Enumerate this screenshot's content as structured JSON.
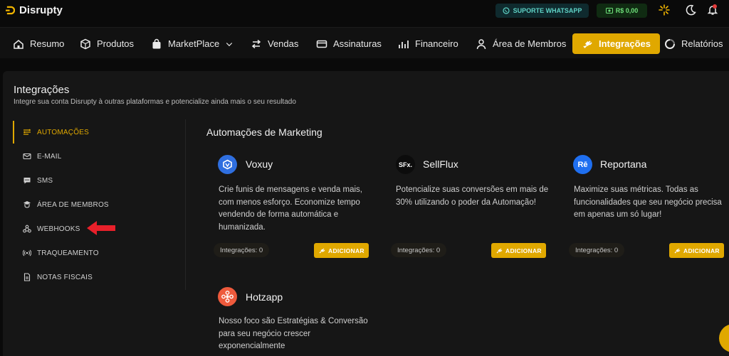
{
  "app": {
    "name": "Disrupty"
  },
  "topbar": {
    "support_label": "SUPORTE WHATSAPP",
    "balance": "R$ 0,00"
  },
  "nav": [
    {
      "label": "Resumo",
      "icon": "home-icon"
    },
    {
      "label": "Produtos",
      "icon": "box-icon"
    },
    {
      "label": "MarketPlace",
      "icon": "bag-icon"
    },
    {
      "label": "Vendas",
      "icon": "arrows-icon"
    },
    {
      "label": "Assinaturas",
      "icon": "card-icon"
    },
    {
      "label": "Financeiro",
      "icon": "chart-icon"
    },
    {
      "label": "Área de Membros",
      "icon": "user-icon"
    },
    {
      "label": "Integrações",
      "icon": "plug-icon",
      "active": true
    },
    {
      "label": "Relatórios",
      "icon": "report-icon"
    }
  ],
  "page": {
    "title": "Integrações",
    "subtitle": "Integre sua conta Disrupty à outras plataformas e potencialize ainda mais o seu resultado"
  },
  "side_menu": [
    {
      "label": "AUTOMAÇÕES",
      "active": true,
      "icon": "automation-icon"
    },
    {
      "label": "E-MAIL",
      "icon": "email-icon"
    },
    {
      "label": "SMS",
      "icon": "sms-icon"
    },
    {
      "label": "ÁREA DE MEMBROS",
      "icon": "members-icon"
    },
    {
      "label": "WEBHOOKS",
      "icon": "webhook-icon"
    },
    {
      "label": "TRAQUEAMENTO",
      "icon": "tracking-icon"
    },
    {
      "label": "NOTAS FISCAIS",
      "icon": "invoice-icon"
    }
  ],
  "section": {
    "title": "Automações de Marketing",
    "add_label": "ADICIONAR",
    "apps": [
      {
        "name": "Voxuy",
        "description": "Crie funis de mensagens e venda mais, com menos esforço. Economize tempo vendendo de forma automática e humanizada.",
        "integrations": "Integrações: 0",
        "logo_color": "#2f6fe0"
      },
      {
        "name": "SellFlux",
        "description": "Potencialize suas conversões em mais de 30% utilizando o poder da Automação!",
        "integrations": "Integrações: 0",
        "logo_color": "#111111",
        "logo_text": "SFx."
      },
      {
        "name": "Reportana",
        "description": "Maximize suas métricas. Todas as funcionalidades que seu negócio precisa em apenas um só lugar!",
        "integrations": "Integrações: 0",
        "logo_color": "#1f6ff0",
        "logo_text": "Rē"
      },
      {
        "name": "Hotzapp",
        "description": "Nosso foco são Estratégias & Conversão para seu negócio crescer exponencialmente",
        "logo_color": "#ee5a3c"
      }
    ]
  },
  "colors": {
    "accent": "#e0a800",
    "background": "#0a0a0a",
    "card": "#161616"
  }
}
